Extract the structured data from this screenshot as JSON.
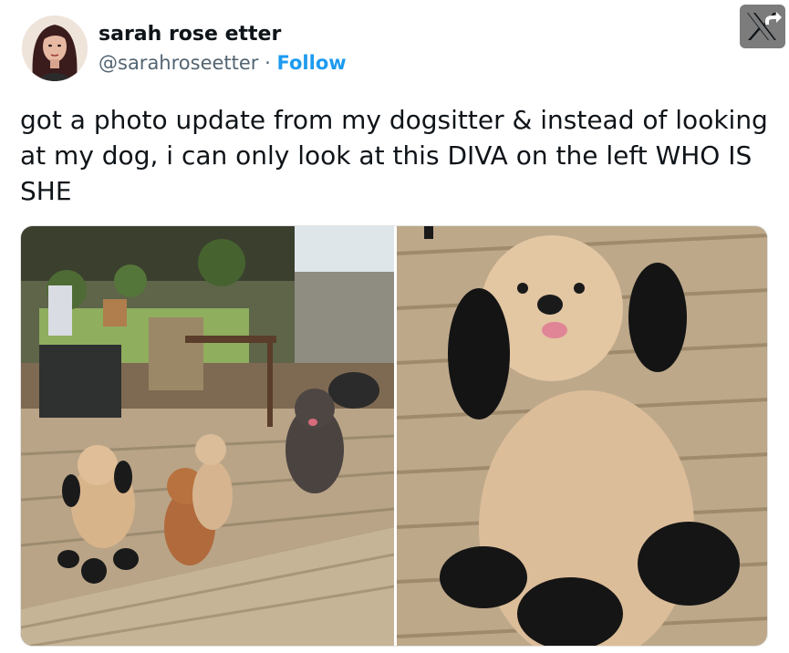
{
  "user": {
    "display_name": "sarah rose etter",
    "handle": "@sarahroseetter",
    "separator": "·",
    "follow_label": "Follow"
  },
  "tweet": {
    "text": "got a photo update from my dogsitter & instead of looking at my dog, i can only look at this DIVA on the left WHO IS SHE"
  },
  "icons": {
    "platform": "x-logo-icon",
    "share": "share-arrow-icon"
  },
  "colors": {
    "link": "#1d9bf0",
    "text": "#0f1419",
    "secondary": "#536471"
  }
}
